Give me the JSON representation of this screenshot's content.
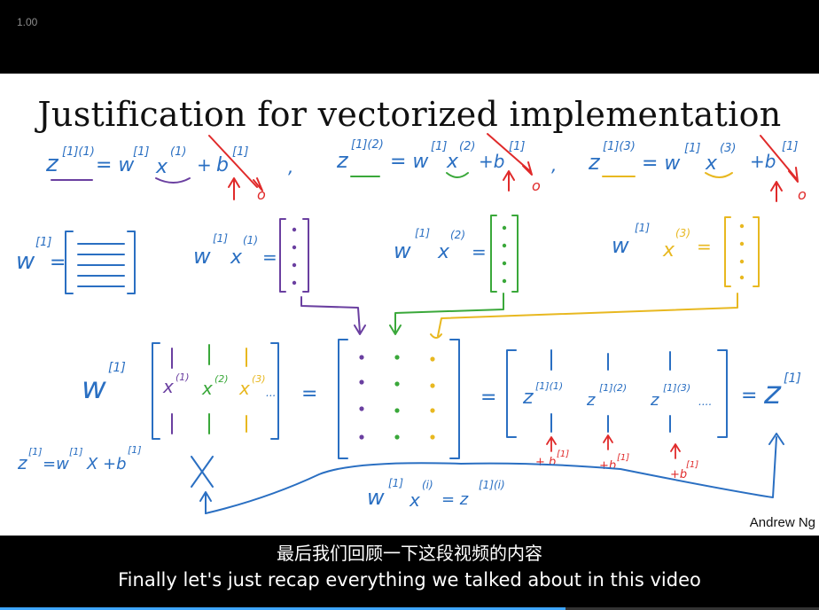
{
  "player": {
    "speed_label": "1.00",
    "progress_fraction": 0.69
  },
  "slide": {
    "title": "Justification for vectorized implementation",
    "author": "Andrew Ng"
  },
  "subtitles": {
    "chinese": "最后我们回顾一下这段视频的内容",
    "english": "Finally let's just recap everything we talked about in this video"
  },
  "colors": {
    "purple": "#6a3fa0",
    "green": "#3aa83a",
    "yellow": "#e8b820",
    "blue": "#2a6fc2",
    "red": "#e02a2a",
    "progress": "#3ea6ff"
  }
}
